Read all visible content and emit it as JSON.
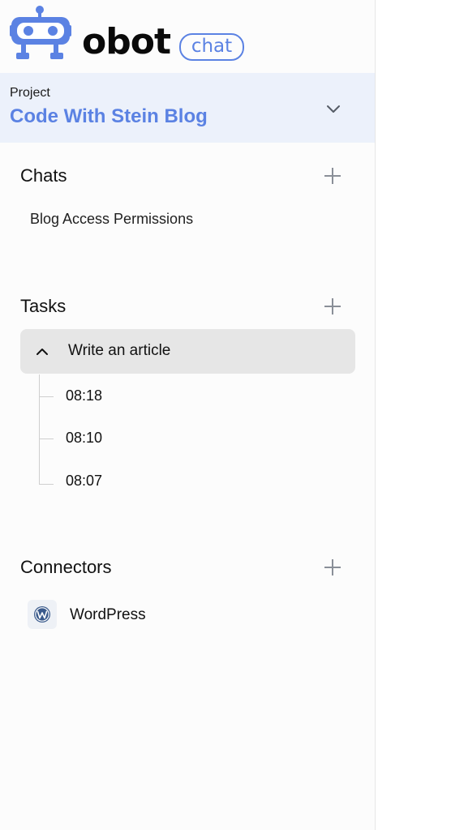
{
  "brand": {
    "wordmark": "obot",
    "badge": "chat",
    "accent_color": "#5b82e3"
  },
  "project": {
    "label": "Project",
    "name": "Code With Stein Blog",
    "chevron_icon": "chevron-down-icon"
  },
  "chats": {
    "title": "Chats",
    "add_icon": "plus-icon",
    "items": [
      "Blog Access Permissions"
    ]
  },
  "tasks": {
    "title": "Tasks",
    "add_icon": "plus-icon",
    "items": [
      {
        "label": "Write an article",
        "expanded": true,
        "runs": [
          "08:18",
          "08:10",
          "08:07"
        ]
      }
    ]
  },
  "connectors": {
    "title": "Connectors",
    "add_icon": "plus-icon",
    "items": [
      {
        "label": "WordPress",
        "icon": "wordpress-icon"
      }
    ]
  }
}
